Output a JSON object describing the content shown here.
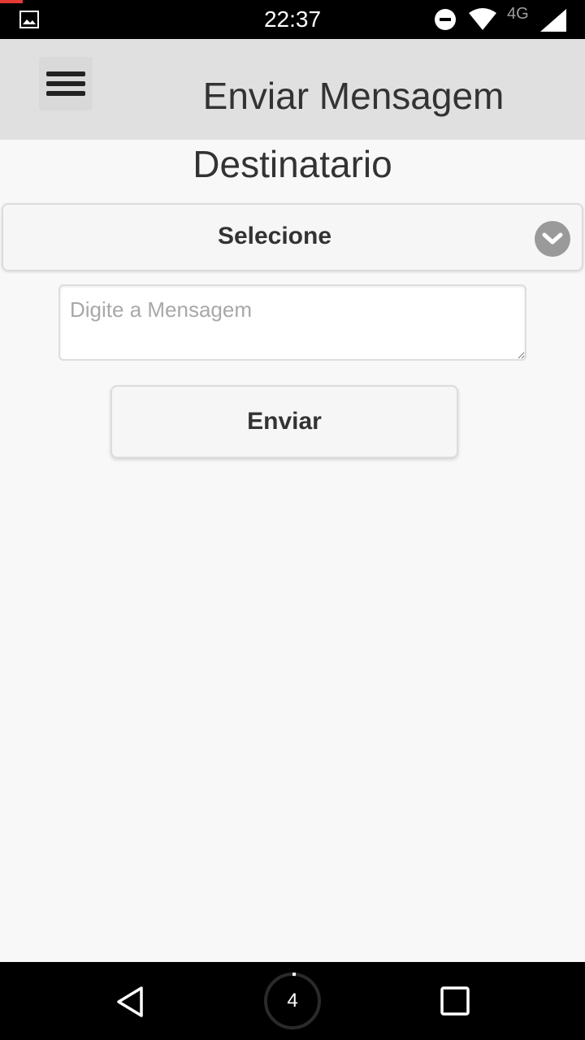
{
  "status_bar": {
    "time": "22:37",
    "network_label": "4G",
    "icons": [
      "gallery-icon",
      "do-not-disturb-icon",
      "wifi-icon",
      "signal-icon"
    ]
  },
  "header": {
    "title": "Enviar Mensagem",
    "menu_icon": "hamburger-menu-icon"
  },
  "form": {
    "section_title": "Destinatario",
    "recipient_select": {
      "selected": "Selecione",
      "icon": "chevron-down-icon"
    },
    "message_input": {
      "value": "",
      "placeholder": "Digite a Mensagem"
    },
    "send_label": "Enviar"
  },
  "nav_bar": {
    "home_count": "4",
    "icons": [
      "back-icon",
      "home-icon",
      "recents-icon"
    ]
  },
  "colors": {
    "header_bg": "#e0e0e0",
    "page_bg": "#f8f8f8",
    "status_accent": "#e53935",
    "chevron_circle": "#9a9a9a"
  }
}
